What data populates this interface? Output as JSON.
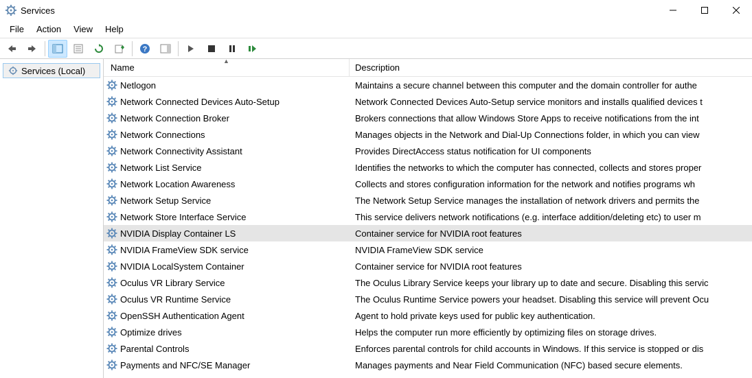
{
  "window": {
    "title": "Services"
  },
  "menu": {
    "file": "File",
    "action": "Action",
    "view": "View",
    "help": "Help"
  },
  "tree": {
    "root": "Services (Local)"
  },
  "columns": {
    "name": "Name",
    "description": "Description"
  },
  "services": [
    {
      "name": "Netlogon",
      "desc": "Maintains a secure channel between this computer and the domain controller for authe",
      "selected": false
    },
    {
      "name": "Network Connected Devices Auto-Setup",
      "desc": "Network Connected Devices Auto-Setup service monitors and installs qualified devices t",
      "selected": false
    },
    {
      "name": "Network Connection Broker",
      "desc": "Brokers connections that allow Windows Store Apps to receive notifications from the int",
      "selected": false
    },
    {
      "name": "Network Connections",
      "desc": "Manages objects in the Network and Dial-Up Connections folder, in which you can view",
      "selected": false
    },
    {
      "name": "Network Connectivity Assistant",
      "desc": "Provides DirectAccess status notification for UI components",
      "selected": false
    },
    {
      "name": "Network List Service",
      "desc": "Identifies the networks to which the computer has connected, collects and stores proper",
      "selected": false
    },
    {
      "name": "Network Location Awareness",
      "desc": "Collects and stores configuration information for the network and notifies programs wh",
      "selected": false
    },
    {
      "name": "Network Setup Service",
      "desc": "The Network Setup Service manages the installation of network drivers and permits the",
      "selected": false
    },
    {
      "name": "Network Store Interface Service",
      "desc": "This service delivers network notifications (e.g. interface addition/deleting etc) to user m",
      "selected": false
    },
    {
      "name": "NVIDIA Display Container LS",
      "desc": "Container service for NVIDIA root features",
      "selected": true
    },
    {
      "name": "NVIDIA FrameView SDK service",
      "desc": "NVIDIA FrameView SDK service",
      "selected": false
    },
    {
      "name": "NVIDIA LocalSystem Container",
      "desc": "Container service for NVIDIA root features",
      "selected": false
    },
    {
      "name": "Oculus VR Library Service",
      "desc": "The Oculus Library Service keeps your library up to date and secure. Disabling this servic",
      "selected": false
    },
    {
      "name": "Oculus VR Runtime Service",
      "desc": "The Oculus Runtime Service powers your headset. Disabling this service will prevent Ocu",
      "selected": false
    },
    {
      "name": "OpenSSH Authentication Agent",
      "desc": "Agent to hold private keys used for public key authentication.",
      "selected": false
    },
    {
      "name": "Optimize drives",
      "desc": "Helps the computer run more efficiently by optimizing files on storage drives.",
      "selected": false
    },
    {
      "name": "Parental Controls",
      "desc": "Enforces parental controls for child accounts in Windows. If this service is stopped or dis",
      "selected": false
    },
    {
      "name": "Payments and NFC/SE Manager",
      "desc": "Manages payments and Near Field Communication (NFC) based secure elements.",
      "selected": false
    }
  ]
}
